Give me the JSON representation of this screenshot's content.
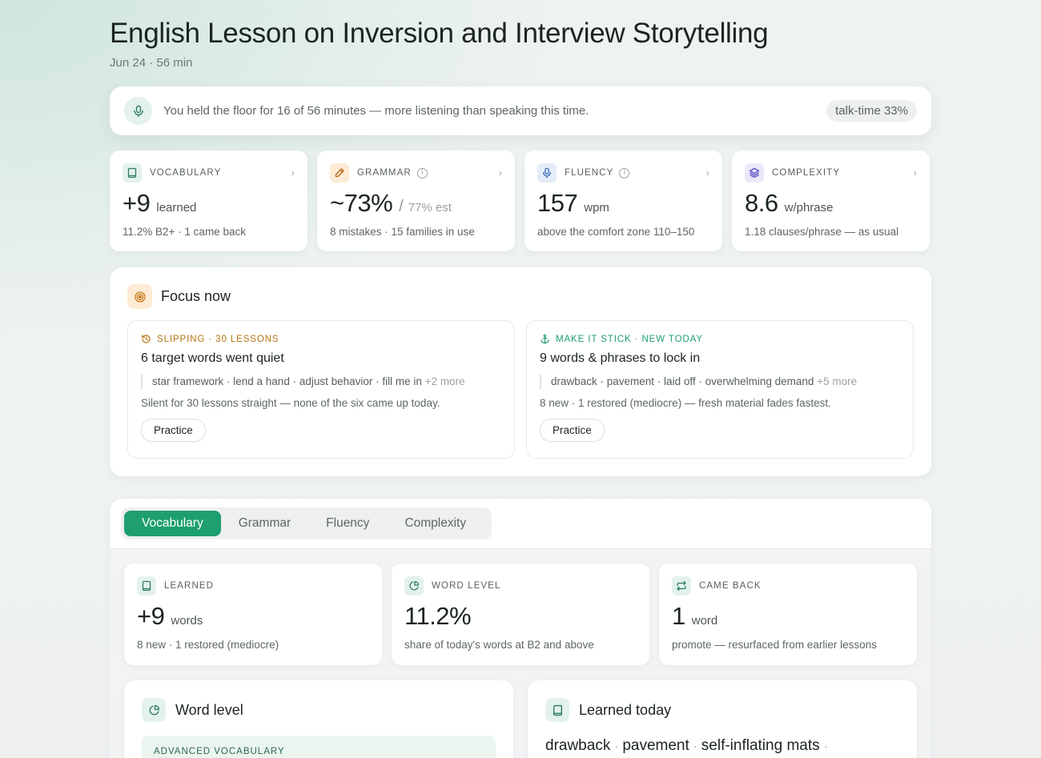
{
  "header": {
    "title": "English Lesson on Inversion and Interview Storytelling",
    "subtitle": "Jun 24 · 56 min"
  },
  "banner": {
    "text": "You held the floor for 16 of 56 minutes — more listening than speaking this time.",
    "pill": "talk-time 33%"
  },
  "kpis": [
    {
      "label": "VOCABULARY",
      "value": "+9",
      "unit": "learned",
      "meta": "11.2% B2+ · 1 came back",
      "color": "#2e7d5f"
    },
    {
      "label": "GRAMMAR",
      "value": "~73%",
      "slash": "/",
      "est": "77% est",
      "meta": "8 mistakes · 15 families in use",
      "color": "#b8641b"
    },
    {
      "label": "FLUENCY",
      "value": "157",
      "unit": "wpm",
      "meta": "above the comfort zone 110–150",
      "color": "#3566b8"
    },
    {
      "label": "COMPLEXITY",
      "value": "8.6",
      "unit": "w/phrase",
      "meta": "1.18 clauses/phrase — as usual",
      "color": "#5b4fc4"
    }
  ],
  "focus": {
    "title": "Focus now",
    "cards": [
      {
        "tag": "SLIPPING · 30 LESSONS",
        "tag_color": "#b5730f",
        "title": "6 target words went quiet",
        "words": "star framework · lend a hand · adjust behavior · fill me in",
        "more": "+2 more",
        "desc": "Silent for 30 lessons straight — none of the six came up today.",
        "button": "Practice"
      },
      {
        "tag": "MAKE IT STICK · NEW TODAY",
        "tag_color": "#1f9d6c",
        "title": "9 words & phrases to lock in",
        "words": "drawback · pavement · laid off · overwhelming demand",
        "more": "+5 more",
        "desc": "8 new · 1 restored (mediocre) — fresh material fades fastest.",
        "button": "Practice"
      }
    ]
  },
  "tabs": [
    "Vocabulary",
    "Grammar",
    "Fluency",
    "Complexity"
  ],
  "stats": [
    {
      "label": "LEARNED",
      "value": "+9",
      "unit": "words",
      "meta": "8 new · 1 restored (mediocre)"
    },
    {
      "label": "WORD LEVEL",
      "value": "11.2%",
      "unit": "",
      "meta": "share of today's words at B2 and above"
    },
    {
      "label": "CAME BACK",
      "value": "1",
      "unit": "word",
      "meta": "promote — resurfaced from earlier lessons"
    }
  ],
  "word_level": {
    "title": "Word level",
    "section": "ADVANCED VOCABULARY"
  },
  "learned_today": {
    "title": "Learned today",
    "words": [
      "drawback",
      "pavement",
      "self-inflating mats"
    ]
  }
}
